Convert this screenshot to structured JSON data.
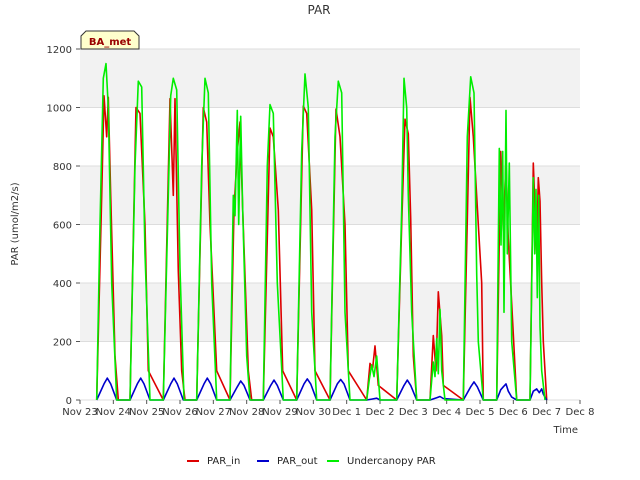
{
  "chart_data": {
    "type": "line",
    "title": "PAR",
    "xlabel": "Time",
    "ylabel": "PAR (umol/m2/s)",
    "badge": "BA_met",
    "ylim": [
      0,
      1200
    ],
    "yticks": [
      0,
      200,
      400,
      600,
      800,
      1000,
      1200
    ],
    "xlim": [
      0,
      15
    ],
    "x_tick_labels": [
      "Nov 23",
      "Nov 24",
      "Nov 25",
      "Nov 26",
      "Nov 27",
      "Nov 28",
      "Nov 29",
      "Nov 30",
      "Dec 1",
      "Dec 2",
      "Dec 3",
      "Dec 4",
      "Dec 5",
      "Dec 6",
      "Dec 7",
      "Dec 8"
    ],
    "grid": true,
    "legend_position": "bottom",
    "colors": {
      "PAR_in": "#dd0000",
      "PAR_out": "#0000cc",
      "Undercanopy PAR": "#00ee00"
    },
    "series": [
      {
        "name": "PAR_in",
        "color": "#dd0000",
        "x": [
          0.5,
          0.65,
          0.72,
          0.8,
          0.85,
          0.92,
          1.05,
          1.15,
          1.5,
          1.68,
          1.8,
          1.95,
          2.05,
          2.5,
          2.7,
          2.8,
          2.85,
          2.95,
          3.05,
          3.15,
          3.5,
          3.7,
          3.8,
          3.9,
          4.1,
          4.5,
          4.62,
          4.72,
          4.8,
          4.88,
          5.05,
          5.15,
          5.5,
          5.7,
          5.8,
          5.95,
          6.08,
          6.5,
          6.7,
          6.8,
          6.95,
          7.05,
          7.5,
          7.68,
          7.8,
          7.95,
          8.05,
          8.6,
          8.7,
          8.78,
          8.85,
          8.95,
          9.5,
          9.65,
          9.75,
          9.85,
          9.92,
          10.0,
          10.1,
          10.5,
          10.6,
          10.68,
          10.75,
          10.85,
          10.9,
          11.5,
          11.7,
          11.8,
          11.95,
          12.05,
          12.1,
          12.5,
          12.62,
          12.7,
          12.78,
          12.85,
          12.95,
          13.1,
          13.5,
          13.6,
          13.7,
          13.75,
          13.8,
          13.85,
          13.9,
          14.0
        ],
        "values": [
          0,
          700,
          1040,
          900,
          1035,
          700,
          150,
          0,
          0,
          1000,
          980,
          600,
          100,
          0,
          1030,
          700,
          1030,
          440,
          100,
          0,
          0,
          1000,
          950,
          600,
          100,
          0,
          650,
          850,
          950,
          650,
          100,
          0,
          0,
          930,
          900,
          650,
          100,
          0,
          1005,
          980,
          650,
          100,
          0,
          995,
          900,
          600,
          100,
          0,
          125,
          110,
          185,
          50,
          0,
          600,
          960,
          910,
          620,
          150,
          0,
          0,
          220,
          100,
          370,
          220,
          50,
          0,
          1035,
          900,
          600,
          400,
          0,
          0,
          850,
          580,
          820,
          550,
          330,
          0,
          0,
          810,
          500,
          760,
          680,
          400,
          200,
          0
        ]
      },
      {
        "name": "PAR_out",
        "color": "#0000cc",
        "x": [
          0.5,
          0.72,
          0.82,
          0.92,
          1.1,
          1.5,
          1.72,
          1.82,
          1.92,
          2.1,
          2.5,
          2.72,
          2.82,
          2.92,
          3.1,
          3.5,
          3.72,
          3.82,
          3.92,
          4.1,
          4.5,
          4.72,
          4.82,
          4.92,
          5.1,
          5.5,
          5.72,
          5.82,
          5.92,
          6.1,
          6.5,
          6.72,
          6.82,
          6.92,
          7.1,
          7.5,
          7.72,
          7.82,
          7.92,
          8.1,
          8.6,
          8.75,
          8.9,
          9.0,
          9.5,
          9.72,
          9.82,
          9.92,
          10.1,
          10.5,
          10.7,
          10.8,
          10.9,
          11.5,
          11.72,
          11.82,
          11.92,
          12.1,
          12.5,
          12.62,
          12.7,
          12.78,
          12.85,
          12.95,
          13.1,
          13.5,
          13.6,
          13.7,
          13.78,
          13.85,
          13.9,
          14.0
        ],
        "values": [
          0,
          55,
          75,
          55,
          0,
          0,
          55,
          75,
          55,
          0,
          0,
          55,
          75,
          55,
          0,
          0,
          55,
          75,
          55,
          0,
          0,
          45,
          65,
          50,
          0,
          0,
          50,
          68,
          50,
          0,
          0,
          55,
          72,
          55,
          0,
          0,
          55,
          70,
          55,
          0,
          0,
          3,
          6,
          0,
          0,
          50,
          68,
          50,
          0,
          0,
          8,
          12,
          5,
          0,
          45,
          62,
          45,
          0,
          0,
          35,
          45,
          55,
          30,
          10,
          0,
          0,
          30,
          38,
          25,
          38,
          20,
          0
        ]
      },
      {
        "name": "Undercanopy PAR",
        "color": "#00ee00",
        "x": [
          0.5,
          0.6,
          0.7,
          0.78,
          0.85,
          0.95,
          1.1,
          1.5,
          1.65,
          1.75,
          1.85,
          1.95,
          2.1,
          2.5,
          2.65,
          2.72,
          2.8,
          2.9,
          3.0,
          3.12,
          3.5,
          3.65,
          3.75,
          3.85,
          3.95,
          4.1,
          4.5,
          4.6,
          4.65,
          4.72,
          4.76,
          4.82,
          4.88,
          5.0,
          5.1,
          5.5,
          5.62,
          5.7,
          5.8,
          5.92,
          6.1,
          6.5,
          6.65,
          6.75,
          6.85,
          6.95,
          7.1,
          7.5,
          7.65,
          7.75,
          7.85,
          7.95,
          8.1,
          8.6,
          8.68,
          8.75,
          8.82,
          8.9,
          9.0,
          9.5,
          9.65,
          9.72,
          9.8,
          9.85,
          9.95,
          10.1,
          10.5,
          10.6,
          10.65,
          10.7,
          10.75,
          10.8,
          10.85,
          10.95,
          11.5,
          11.62,
          11.72,
          11.82,
          11.9,
          11.95,
          12.1,
          12.5,
          12.58,
          12.63,
          12.68,
          12.72,
          12.78,
          12.82,
          12.88,
          12.95,
          13.1,
          13.5,
          13.6,
          13.64,
          13.68,
          13.72,
          13.76,
          13.8,
          13.85,
          13.95
        ],
        "values": [
          0,
          600,
          1100,
          1150,
          1000,
          400,
          0,
          0,
          800,
          1090,
          1070,
          500,
          0,
          0,
          700,
          1040,
          1100,
          1060,
          450,
          0,
          0,
          800,
          1100,
          1050,
          400,
          0,
          0,
          700,
          630,
          990,
          600,
          970,
          650,
          150,
          0,
          0,
          800,
          1010,
          980,
          400,
          0,
          0,
          850,
          1115,
          1000,
          300,
          0,
          0,
          900,
          1090,
          1050,
          300,
          0,
          0,
          70,
          120,
          80,
          150,
          0,
          0,
          650,
          1100,
          1000,
          700,
          300,
          0,
          0,
          130,
          80,
          210,
          90,
          310,
          100,
          0,
          0,
          900,
          1105,
          1050,
          430,
          200,
          0,
          0,
          860,
          530,
          850,
          300,
          990,
          500,
          810,
          200,
          0,
          0,
          760,
          500,
          720,
          350,
          700,
          250,
          100,
          0
        ]
      }
    ]
  }
}
